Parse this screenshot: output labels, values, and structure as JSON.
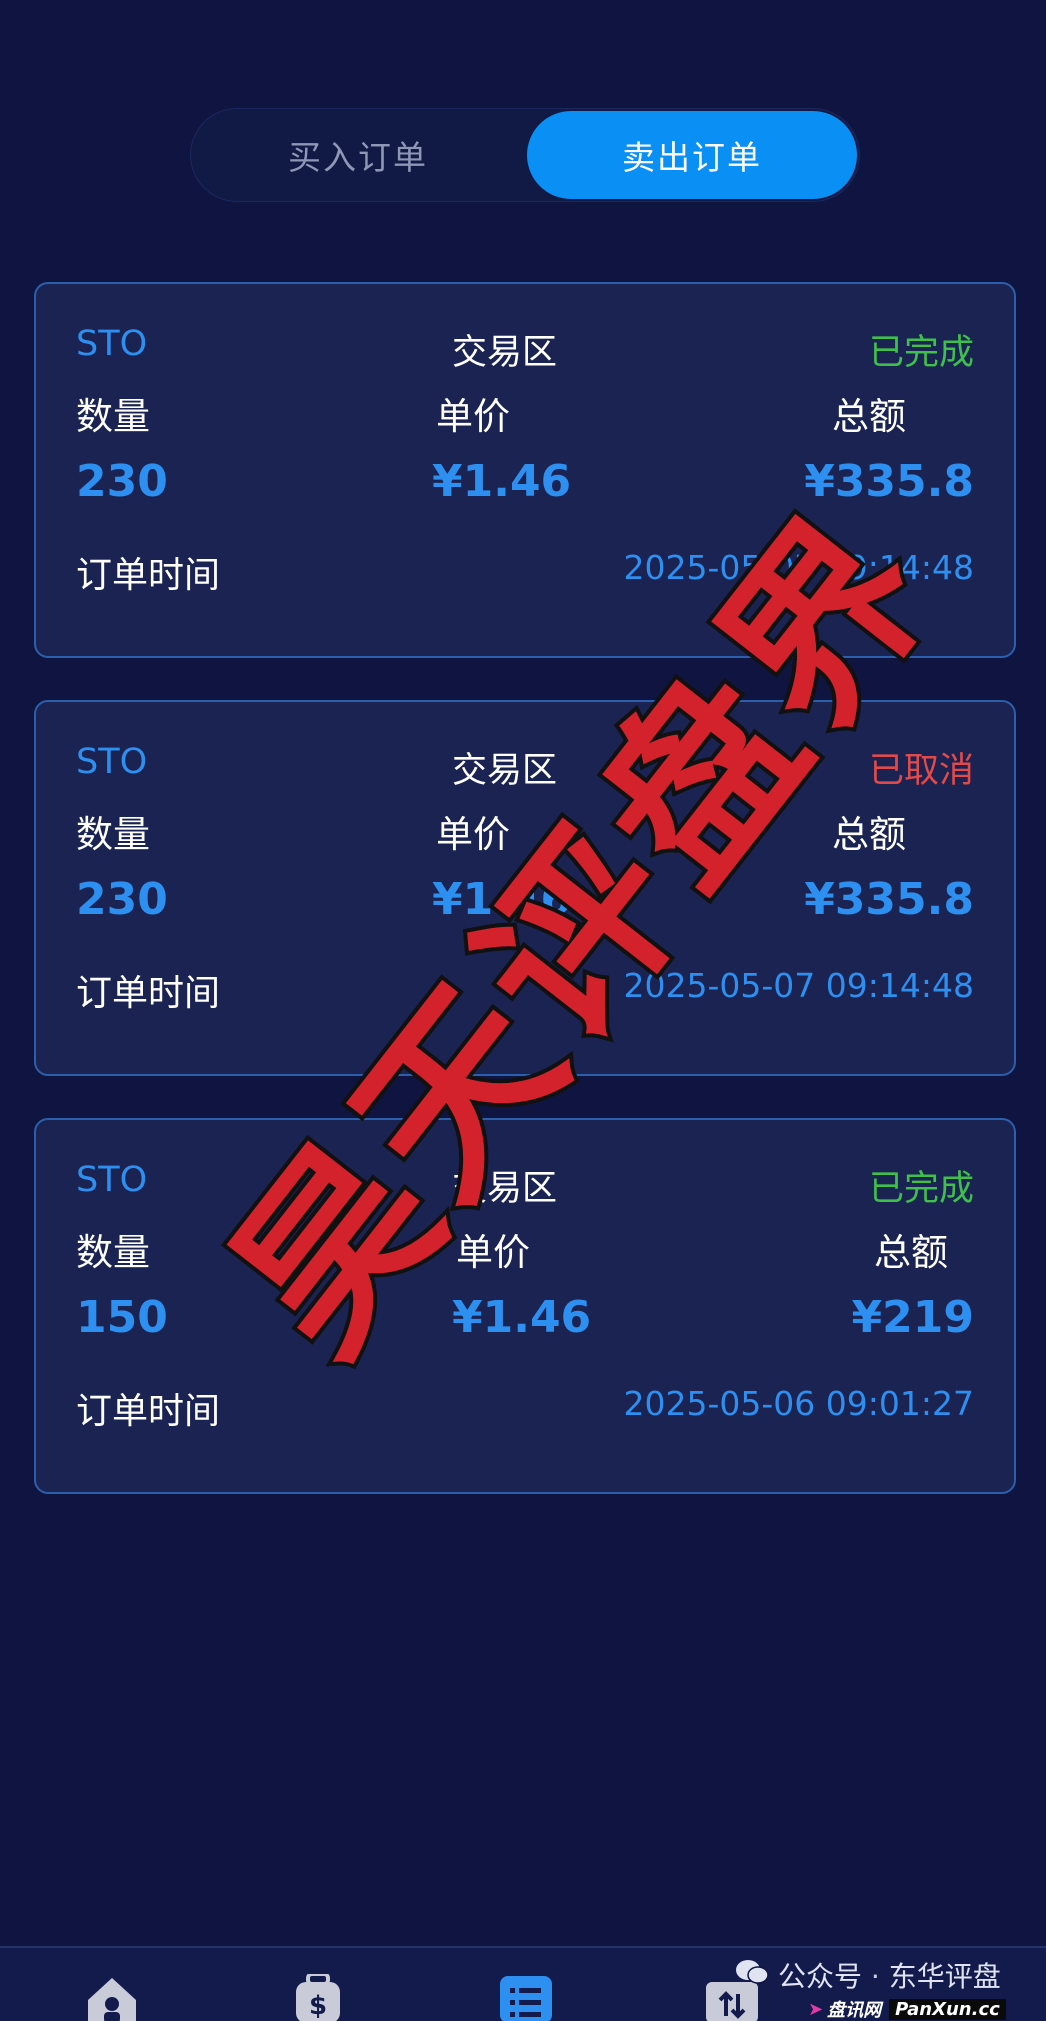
{
  "tabs": {
    "buy_label": "买入订单",
    "sell_label": "卖出订单",
    "active": "sell"
  },
  "orders": [
    {
      "symbol": "STO",
      "zone": "交易区",
      "status": "已完成",
      "status_type": "done",
      "qty_label": "数量",
      "price_label": "单价",
      "total_label": "总额",
      "qty": "230",
      "price": "¥1.46",
      "total": "¥335.8",
      "time_label": "订单时间",
      "time": "2025-05-07 09:14:48"
    },
    {
      "symbol": "STO",
      "zone": "交易区",
      "status": "已取消",
      "status_type": "cancel",
      "qty_label": "数量",
      "price_label": "单价",
      "total_label": "总额",
      "qty": "230",
      "price": "¥1.46",
      "total": "¥335.8",
      "time_label": "订单时间",
      "time": "2025-05-07 09:14:48"
    },
    {
      "symbol": "STO",
      "zone": "交易区",
      "status": "已完成",
      "status_type": "done",
      "qty_label": "数量",
      "price_label": "单价",
      "total_label": "总额",
      "qty": "150",
      "price": "¥1.46",
      "total": "¥219",
      "time_label": "订单时间",
      "time": "2025-05-06 09:01:27"
    }
  ],
  "watermark": {
    "text": "昊天评盘界"
  },
  "footer": {
    "wechat_text": "公众号",
    "wechat_sep": "·",
    "wechat_name": "东华评盘",
    "site_label": "盘讯网",
    "site_domain": "PanXun.cc"
  },
  "icons": {
    "nav": [
      "home-icon",
      "wallet-icon",
      "orders-icon",
      "exchange-icon"
    ],
    "active_color": "#2d8ff0",
    "inactive_color": "#c9cbd8"
  }
}
